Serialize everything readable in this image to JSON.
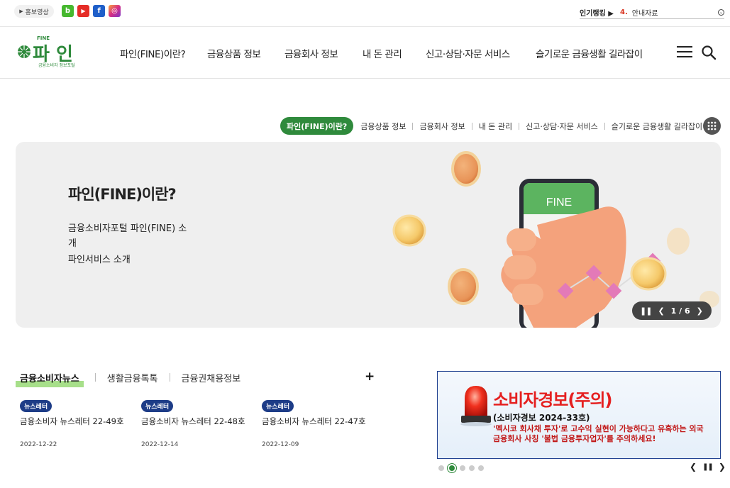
{
  "util": {
    "promo_label": "홍보영상",
    "sns": [
      "b",
      "▶",
      "f",
      "◎"
    ],
    "rank_label": "인기랭킹 ▶",
    "rank_number": "4.",
    "rank_item": "안내자료"
  },
  "logo": {
    "small": "FINE",
    "big": "파 인",
    "caption": "금융소비자 정보포털"
  },
  "gnb": {
    "items": [
      "파인(FINE)이란?",
      "금융상품 정보",
      "금융회사 정보",
      "내 돈 관리",
      "신고·상담·자문 서비스",
      "슬기로운 금융생활 길라잡이"
    ]
  },
  "subnav": {
    "active": "파인(FINE)이란?",
    "items": [
      "금융상품 정보",
      "금융회사 정보",
      "내 돈 관리",
      "신고·상담·자문 서비스",
      "슬기로운 금융생활 길라잡이"
    ]
  },
  "banner": {
    "title": "파인(FINE)이란?",
    "desc": "금융소비자포털 파인(FINE) 소개",
    "desc2": "파인서비스 소개",
    "phone_label": "FINE",
    "page": "1 / 6"
  },
  "tabs": [
    "금융소비자뉴스",
    "생활금융톡톡",
    "금융권채용정보"
  ],
  "plus": "+",
  "news": [
    {
      "badge": "뉴스레터",
      "title": "금융소비자 뉴스레터 22-49호",
      "date": "2022-12-22"
    },
    {
      "badge": "뉴스레터",
      "title": "금융소비자 뉴스레터 22-48호",
      "date": "2022-12-14"
    },
    {
      "badge": "뉴스레터",
      "title": "금융소비자 뉴스레터 22-47호",
      "date": "2022-12-09"
    }
  ],
  "alert": {
    "title": "소비자경보(주의)",
    "sub": "(소비자경보 2024-33호)",
    "desc": "'멕시코 회사채 투자'로 고수익 실현이 가능하다고 유혹하는 외국 금융회사 사칭 '불법 금융투자업자'를 주의하세요!"
  },
  "colors": {
    "brand_green": "#2f8a3c",
    "navy": "#1d3c87",
    "alert_red": "#e52020"
  }
}
